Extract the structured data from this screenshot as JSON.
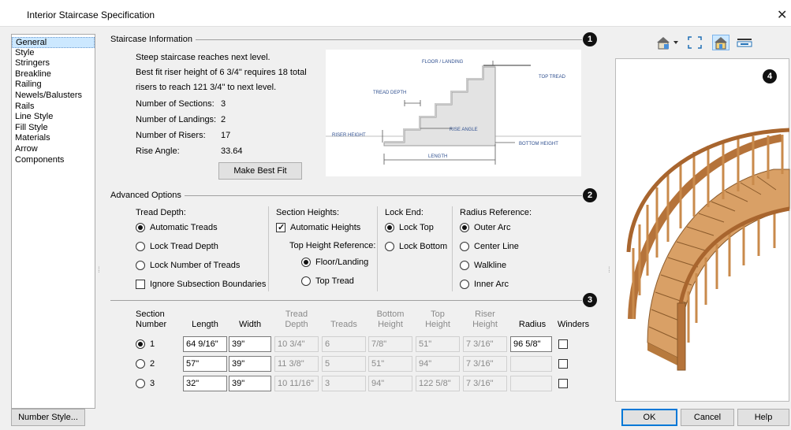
{
  "window": {
    "title": "Interior Staircase Specification",
    "close_glyph": "✕"
  },
  "sidebar": {
    "items": [
      {
        "label": "General",
        "selected": true
      },
      {
        "label": "Style"
      },
      {
        "label": "Stringers"
      },
      {
        "label": "Breakline"
      },
      {
        "label": "Railing"
      },
      {
        "label": "Newels/Balusters"
      },
      {
        "label": "Rails"
      },
      {
        "label": "Line Style"
      },
      {
        "label": "Fill Style"
      },
      {
        "label": "Materials"
      },
      {
        "label": "Arrow"
      },
      {
        "label": "Components"
      }
    ]
  },
  "staircase_info": {
    "group_label": "Staircase Information",
    "badge": "1",
    "line1": "Steep staircase reaches next level.",
    "line2": "Best fit riser height of 6 3/4\" requires 18 total",
    "line3": "risers to reach 121 3/4\" to next level.",
    "sections_label": "Number of Sections:",
    "sections_value": "3",
    "landings_label": "Number of Landings:",
    "landings_value": "2",
    "risers_label": "Number of Risers:",
    "risers_value": "17",
    "angle_label": "Rise Angle:",
    "angle_value": "33.64",
    "best_fit_button": "Make Best Fit"
  },
  "diagram": {
    "floor_landing": "FLOOR / LANDING",
    "top_tread": "TOP TREAD",
    "tread_depth": "TREAD DEPTH",
    "riser_height": "RISER HEIGHT",
    "rise_angle": "RISE ANGLE",
    "bottom_height": "BOTTOM HEIGHT",
    "length": "LENGTH"
  },
  "advanced": {
    "group_label": "Advanced Options",
    "badge": "2",
    "tread_depth_label": "Tread Depth:",
    "automatic_treads": "Automatic Treads",
    "lock_tread_depth": "Lock Tread Depth",
    "lock_number_treads": "Lock Number of Treads",
    "ignore_subsection": "Ignore Subsection Boundaries",
    "section_heights_label": "Section Heights:",
    "automatic_heights": "Automatic Heights",
    "top_height_ref_label": "Top Height Reference:",
    "floor_landing": "Floor/Landing",
    "top_tread": "Top Tread",
    "lock_end_label": "Lock End:",
    "lock_top": "Lock Top",
    "lock_bottom": "Lock Bottom",
    "radius_ref_label": "Radius Reference:",
    "outer_arc": "Outer Arc",
    "center_line": "Center Line",
    "walkline": "Walkline",
    "inner_arc": "Inner Arc"
  },
  "sections": {
    "badge": "3",
    "headers": {
      "section_1": "Section",
      "section_2": "Number",
      "length": "Length",
      "width": "Width",
      "tread_1": "Tread",
      "tread_2": "Depth",
      "treads": "Treads",
      "bottom_1": "Bottom",
      "bottom_2": "Height",
      "top_1": "Top",
      "top_2": "Height",
      "riser_1": "Riser",
      "riser_2": "Height",
      "radius": "Radius",
      "winders": "Winders"
    },
    "rows": [
      {
        "num": "1",
        "length": "64 9/16\"",
        "width": "39\"",
        "tread_depth": "10 3/4\"",
        "treads": "6",
        "bottom": "7/8\"",
        "top": "51\"",
        "riser": "7 3/16\"",
        "radius": "96 5/8\""
      },
      {
        "num": "2",
        "length": "57\"",
        "width": "39\"",
        "tread_depth": "11 3/8\"",
        "treads": "5",
        "bottom": "51\"",
        "top": "94\"",
        "riser": "7 3/16\"",
        "radius": ""
      },
      {
        "num": "3",
        "length": "32\"",
        "width": "39\"",
        "tread_depth": "10 11/16\"",
        "treads": "3",
        "bottom": "94\"",
        "top": "122 5/8\"",
        "riser": "7 3/16\"",
        "radius": ""
      }
    ]
  },
  "preview": {
    "badge": "4"
  },
  "footer": {
    "number_style": "Number Style...",
    "ok": "OK",
    "cancel": "Cancel",
    "help": "Help"
  },
  "colors": {
    "selection": "#cce8ff",
    "wood": "#d9a066",
    "default_button_border": "#0078d7"
  }
}
